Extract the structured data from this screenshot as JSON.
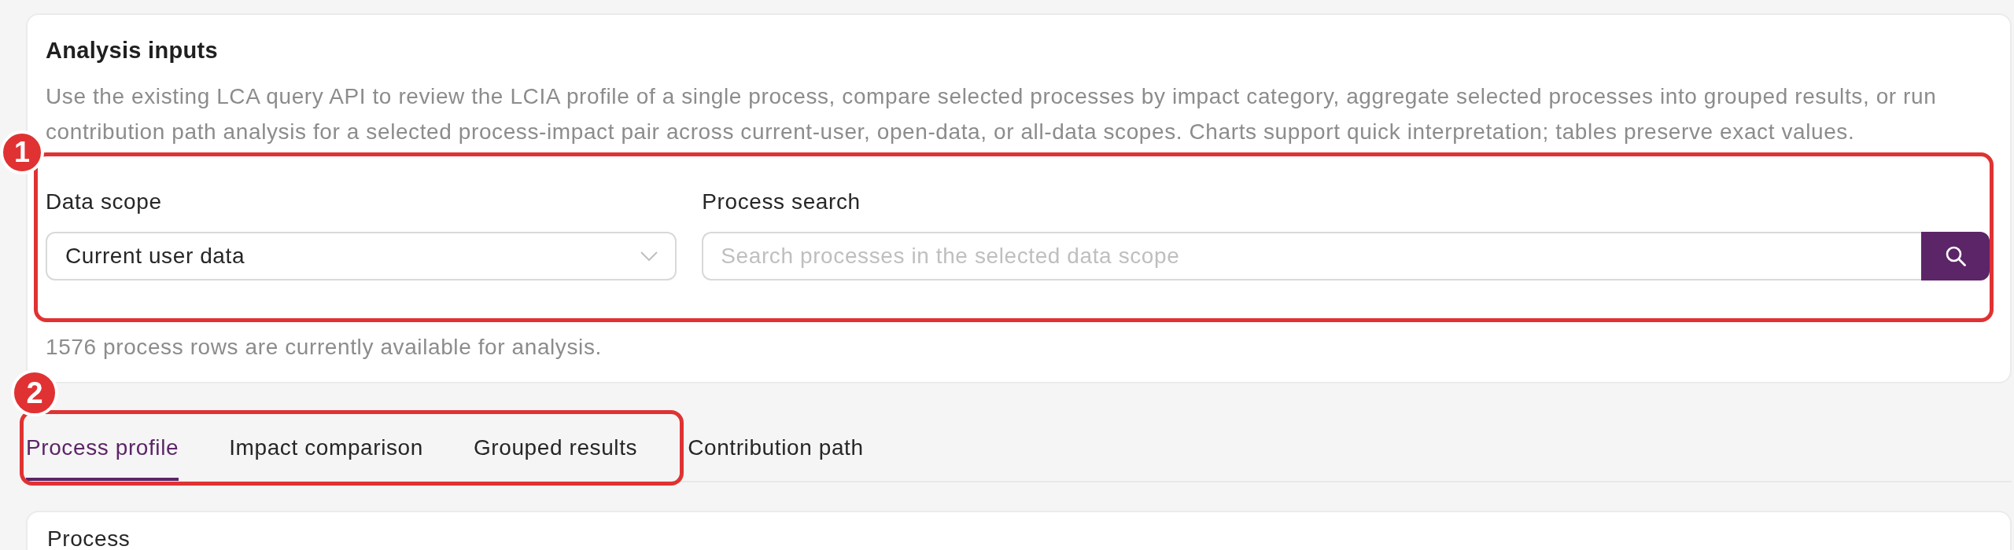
{
  "analysis_inputs": {
    "title": "Analysis inputs",
    "description": "Use the existing LCA query API to review the LCIA profile of a single process, compare selected processes by impact category, aggregate selected processes into grouped results, or run contribution path analysis for a selected process-impact pair across current-user, open-data, or all-data scopes. Charts support quick interpretation; tables preserve exact values.",
    "annotation": {
      "label": "1"
    },
    "data_scope": {
      "label": "Data scope",
      "value": "Current user data"
    },
    "process_search": {
      "label": "Process search",
      "placeholder": "Search processes in the selected data scope"
    },
    "note": "1576 process rows are currently available for analysis."
  },
  "tab_bar": {
    "annotation": {
      "label": "2"
    },
    "tabs": [
      {
        "label": "Process profile",
        "selected": true,
        "annotated": true
      },
      {
        "label": "Impact comparison",
        "selected": false,
        "annotated": true
      },
      {
        "label": "Grouped results",
        "selected": false,
        "annotated": true
      },
      {
        "label": "Contribution path",
        "selected": false,
        "annotated": false
      }
    ]
  },
  "process_panel": {
    "label": "Process"
  }
}
